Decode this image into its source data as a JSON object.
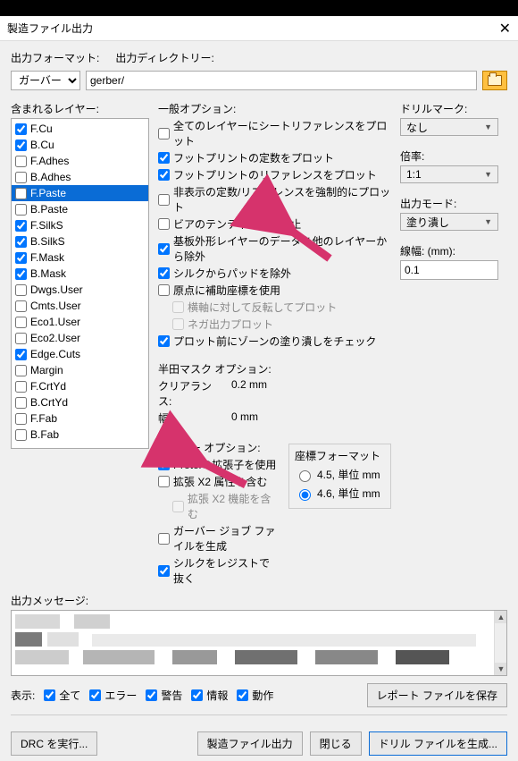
{
  "window": {
    "title": "製造ファイル出力"
  },
  "outputFormat": {
    "label": "出力フォーマット:",
    "value": "ガーバー"
  },
  "outputDir": {
    "label": "出力ディレクトリー:",
    "value": "gerber/"
  },
  "layersGroup": {
    "label": "含まれるレイヤー:"
  },
  "layers": [
    {
      "name": "F.Cu",
      "checked": true,
      "selected": false
    },
    {
      "name": "B.Cu",
      "checked": true,
      "selected": false
    },
    {
      "name": "F.Adhes",
      "checked": false,
      "selected": false
    },
    {
      "name": "B.Adhes",
      "checked": false,
      "selected": false
    },
    {
      "name": "F.Paste",
      "checked": false,
      "selected": true
    },
    {
      "name": "B.Paste",
      "checked": false,
      "selected": false
    },
    {
      "name": "F.SilkS",
      "checked": true,
      "selected": false
    },
    {
      "name": "B.SilkS",
      "checked": true,
      "selected": false
    },
    {
      "name": "F.Mask",
      "checked": true,
      "selected": false
    },
    {
      "name": "B.Mask",
      "checked": true,
      "selected": false
    },
    {
      "name": "Dwgs.User",
      "checked": false,
      "selected": false
    },
    {
      "name": "Cmts.User",
      "checked": false,
      "selected": false
    },
    {
      "name": "Eco1.User",
      "checked": false,
      "selected": false
    },
    {
      "name": "Eco2.User",
      "checked": false,
      "selected": false
    },
    {
      "name": "Edge.Cuts",
      "checked": true,
      "selected": false
    },
    {
      "name": "Margin",
      "checked": false,
      "selected": false
    },
    {
      "name": "F.CrtYd",
      "checked": false,
      "selected": false
    },
    {
      "name": "B.CrtYd",
      "checked": false,
      "selected": false
    },
    {
      "name": "F.Fab",
      "checked": false,
      "selected": false
    },
    {
      "name": "B.Fab",
      "checked": false,
      "selected": false
    }
  ],
  "generalOptions": {
    "label": "一般オプション:",
    "items": [
      {
        "label": "全てのレイヤーにシートリファレンスをプロット",
        "checked": false
      },
      {
        "label": "フットプリントの定数をプロット",
        "checked": true
      },
      {
        "label": "フットプリントのリファレンスをプロット",
        "checked": true
      },
      {
        "label": "非表示の定数/リファレンスを強制的にプロット",
        "checked": false
      },
      {
        "label": "ビアのテンティングを禁止",
        "checked": false
      },
      {
        "label": "基板外形レイヤーのデータを他のレイヤーから除外",
        "checked": true
      },
      {
        "label": "シルクからパッドを除外",
        "checked": true
      },
      {
        "label": "原点に補助座標を使用",
        "checked": false
      },
      {
        "label": "横軸に対して反転してプロット",
        "checked": false,
        "disabled": true,
        "indent": true
      },
      {
        "label": "ネガ出力プロット",
        "checked": false,
        "disabled": true,
        "indent": true
      },
      {
        "label": "プロット前にゾーンの塗り潰しをチェック",
        "checked": true
      }
    ]
  },
  "drillMarks": {
    "label": "ドリルマーク:",
    "value": "なし"
  },
  "scale": {
    "label": "倍率:",
    "value": "1:1"
  },
  "outputMode": {
    "label": "出力モード:",
    "value": "塗り潰し"
  },
  "lineWidth": {
    "label": "線幅: (mm):",
    "value": "0.1"
  },
  "solderMask": {
    "label": "半田マスク オプション:",
    "clearance": {
      "label": "クリアランス:",
      "value": "0.2 mm"
    },
    "width": {
      "label": "幅:",
      "value": "0 mm"
    }
  },
  "gerberOptions": {
    "label": "ガーバー オプション:",
    "items": [
      {
        "label": "Protelの拡張子を使用",
        "checked": true
      },
      {
        "label": "拡張 X2 属性を含む",
        "checked": false
      },
      {
        "label": "拡張 X2 機能を含む",
        "checked": false,
        "disabled": true,
        "indent": true
      },
      {
        "label": "ガーバー ジョブ ファイルを生成",
        "checked": false
      },
      {
        "label": "シルクをレジストで抜く",
        "checked": true
      }
    ]
  },
  "coordFormat": {
    "label": "座標フォーマット",
    "options": [
      {
        "label": "4.5, 単位 mm",
        "checked": false
      },
      {
        "label": "4.6, 単位 mm",
        "checked": true
      }
    ]
  },
  "messages": {
    "label": "出力メッセージ:"
  },
  "showBar": {
    "label": "表示:",
    "all": "全て",
    "errors": "エラー",
    "warnings": "警告",
    "infos": "情報",
    "actions": "動作",
    "saveReport": "レポート ファイルを保存"
  },
  "footer": {
    "drc": "DRC を実行...",
    "plot": "製造ファイル出力",
    "close": "閉じる",
    "drill": "ドリル ファイルを生成..."
  }
}
